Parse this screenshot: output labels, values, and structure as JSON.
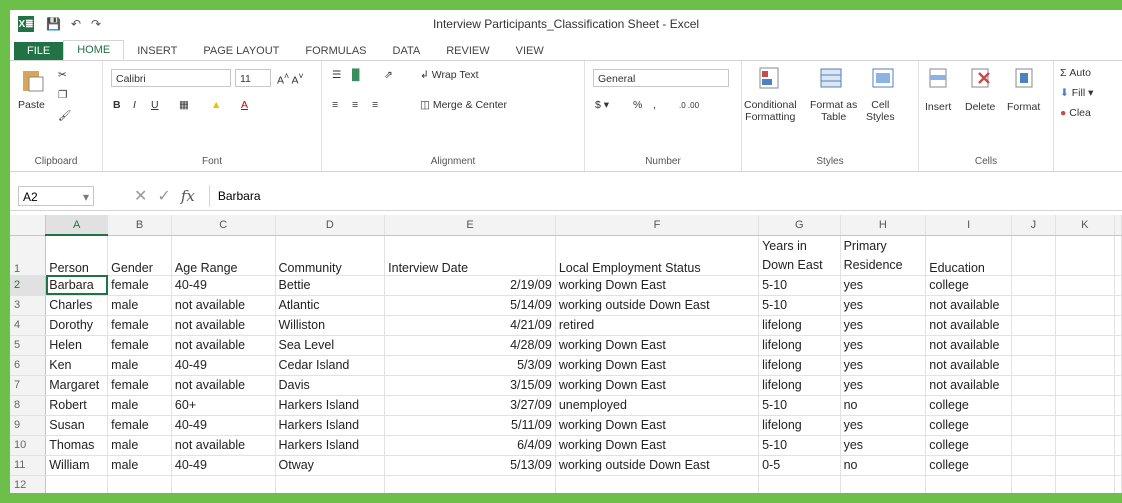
{
  "window": {
    "title": "Interview Participants_Classification Sheet - Excel",
    "logo": "X≣"
  },
  "tabs": [
    "FILE",
    "HOME",
    "INSERT",
    "PAGE LAYOUT",
    "FORMULAS",
    "DATA",
    "REVIEW",
    "VIEW"
  ],
  "ribbon": {
    "clipboard": {
      "paste": "Paste",
      "label": "Clipboard"
    },
    "font": {
      "name": "Calibri",
      "size": "11",
      "label": "Font"
    },
    "alignment": {
      "wrap_text": "Wrap Text",
      "merge_center": "Merge & Center",
      "label": "Alignment"
    },
    "number": {
      "format": "General",
      "label": "Number"
    },
    "styles": {
      "conditional": "Conditional",
      "formatting": "Formatting",
      "format_as": "Format as",
      "table": "Table",
      "cell": "Cell",
      "cell_styles": "Styles",
      "label": "Styles"
    },
    "cells": {
      "insert": "Insert",
      "delete": "Delete",
      "format": "Format",
      "label": "Cells"
    },
    "editing": {
      "autosum": "Auto",
      "fill": "Fill",
      "clear": "Clea"
    }
  },
  "formula_bar": {
    "name_box": "A2",
    "fx": "fx",
    "value": "Barbara"
  },
  "sheet": {
    "columns": [
      "A",
      "B",
      "C",
      "D",
      "E",
      "F",
      "G",
      "H",
      "I",
      "J",
      "K"
    ],
    "header_row": [
      "Person",
      "Gender",
      "Age Range",
      "Community",
      "Interview Date",
      "Local Employment Status",
      "Years in Down East",
      "Primary Residence",
      "Education"
    ],
    "rows": [
      [
        "Barbara",
        "female",
        "40-49",
        "Bettie",
        "2/19/09",
        "working Down East",
        "5-10",
        "yes",
        "college"
      ],
      [
        "Charles",
        "male",
        "not available",
        "Atlantic",
        "5/14/09",
        "working outside Down East",
        "5-10",
        "yes",
        "not available"
      ],
      [
        "Dorothy",
        "female",
        "not available",
        "Williston",
        "4/21/09",
        "retired",
        "lifelong",
        "yes",
        "not available"
      ],
      [
        "Helen",
        "female",
        "not available",
        "Sea Level",
        "4/28/09",
        "working Down East",
        "lifelong",
        "yes",
        "not available"
      ],
      [
        "Ken",
        "male",
        "40-49",
        "Cedar Island",
        "5/3/09",
        "working Down East",
        "lifelong",
        "yes",
        "not available"
      ],
      [
        "Margaret",
        "female",
        "not available",
        "Davis",
        "3/15/09",
        "working Down East",
        "lifelong",
        "yes",
        "not available"
      ],
      [
        "Robert",
        "male",
        "60+",
        "Harkers Island",
        "3/27/09",
        "unemployed",
        "5-10",
        "no",
        "college"
      ],
      [
        "Susan",
        "female",
        "40-49",
        "Harkers Island",
        "5/11/09",
        "working Down East",
        "lifelong",
        "yes",
        "college"
      ],
      [
        "Thomas",
        "male",
        "not available",
        "Harkers Island",
        "6/4/09",
        "working Down East",
        "5-10",
        "yes",
        "college"
      ],
      [
        "William",
        "male",
        "40-49",
        "Otway",
        "5/13/09",
        "working outside Down East",
        "0-5",
        "no",
        "college"
      ]
    ],
    "row_numbers": [
      "1",
      "2",
      "3",
      "4",
      "5",
      "6",
      "7",
      "8",
      "9",
      "10",
      "11",
      "12"
    ]
  },
  "colors": {
    "accent": "#217346",
    "frame": "#6cc04a"
  }
}
